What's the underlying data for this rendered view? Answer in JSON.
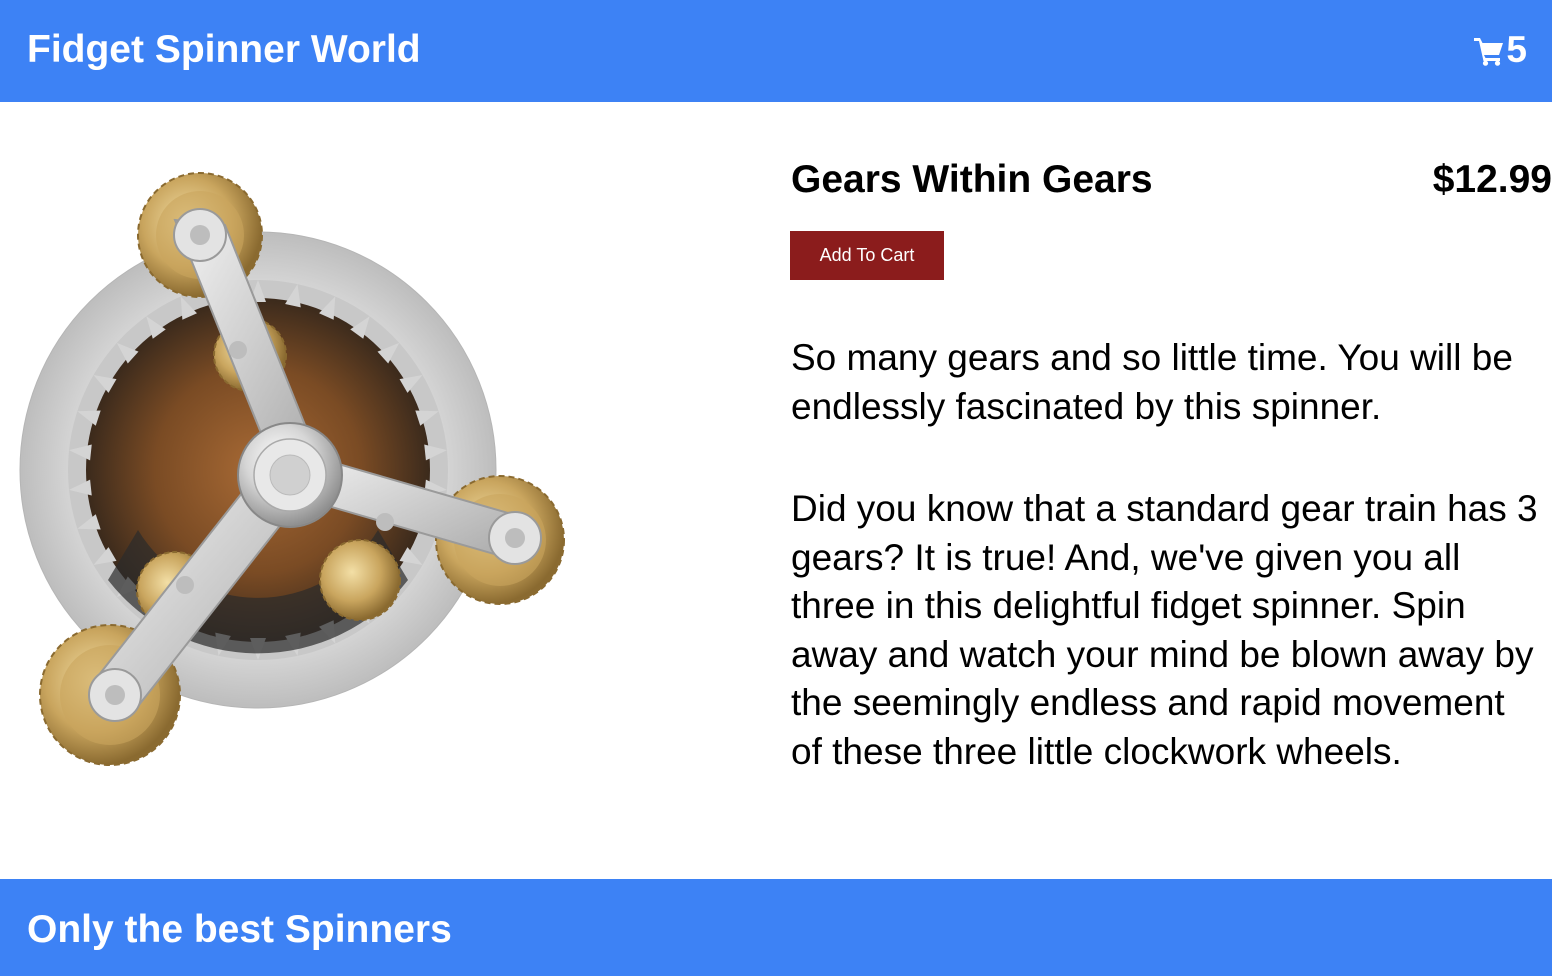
{
  "header": {
    "title": "Fidget Spinner World",
    "cart_icon": "shopping-cart-icon",
    "cart_count": "5"
  },
  "product": {
    "name": "Gears Within Gears",
    "price": "$12.99",
    "add_to_cart_label": "Add To Cart",
    "image_icon": "gear-fidget-spinner-image",
    "description": [
      "So many gears and so little time. You will be endlessly fascinated by this spinner.",
      "Did you know that a standard gear train has 3 gears? It is true! And, we've given you all three in this delightful fidget spinner. Spin away and watch your mind be blown away by the seemingly endless and rapid movement of these three little clockwork wheels."
    ]
  },
  "footer": {
    "tagline": "Only the best Spinners"
  },
  "colors": {
    "header_bg": "#3d82f5",
    "footer_bg": "#3d82f5",
    "button_bg": "#8b1c1c",
    "text": "#000000",
    "header_text": "#ffffff"
  }
}
